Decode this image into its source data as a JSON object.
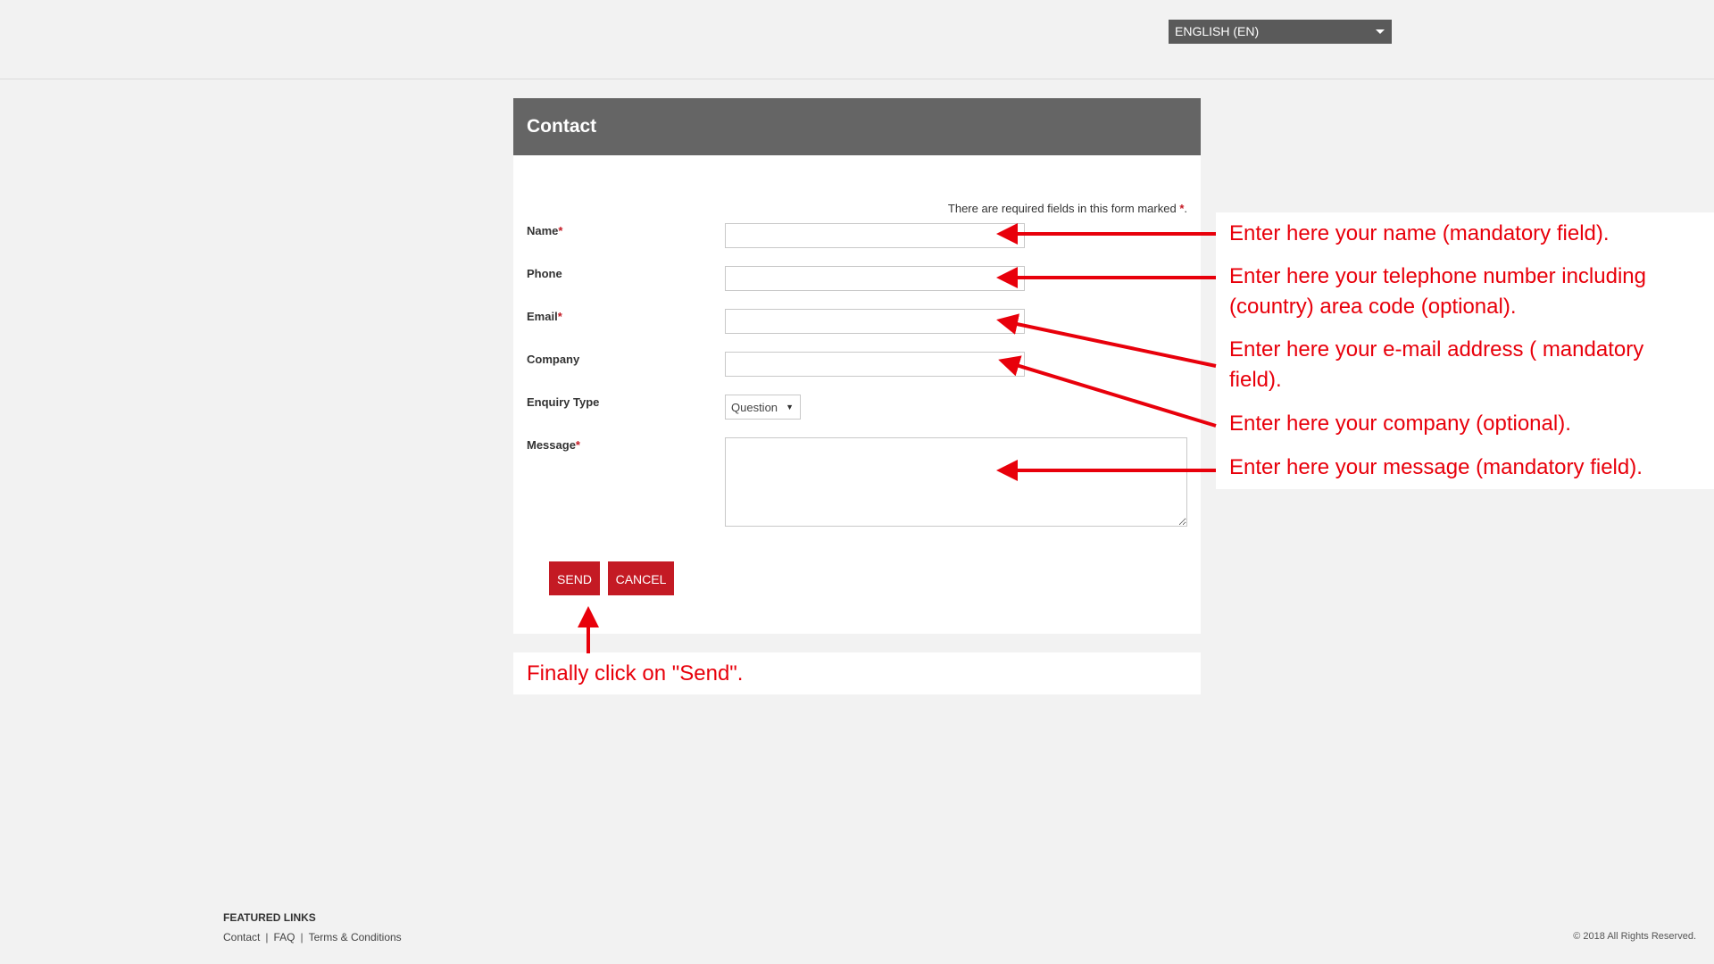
{
  "header": {
    "language_select": {
      "value": "ENGLISH (EN)",
      "icon": "caret-down-icon"
    }
  },
  "form": {
    "title": "Contact",
    "required_note": "There are required fields in this form marked",
    "required_marker": "*",
    "required_period": ".",
    "fields": {
      "name": {
        "label": "Name",
        "required": true,
        "value": ""
      },
      "phone": {
        "label": "Phone",
        "required": false,
        "value": ""
      },
      "email": {
        "label": "Email",
        "required": true,
        "value": ""
      },
      "company": {
        "label": "Company",
        "required": false,
        "value": ""
      },
      "enquiry_type": {
        "label": "Enquiry Type",
        "value": "Question"
      },
      "message": {
        "label": "Message",
        "required": true,
        "value": ""
      }
    },
    "buttons": {
      "send": "SEND",
      "cancel": "CANCEL"
    }
  },
  "annotations": {
    "name": "Enter here your name (mandatory field).",
    "phone": "Enter here your telephone number including (country) area code (optional).",
    "email": "Enter here your e-mail address ( mandatory field).",
    "company": "Enter here your company (optional).",
    "message": "Enter here your message (mandatory field).",
    "send": "Finally click on \"Send\"."
  },
  "footer": {
    "heading": "FEATURED LINKS",
    "links": [
      "Contact",
      "FAQ",
      "Terms & Conditions"
    ],
    "separator": "|",
    "copyright": "© 2018 All Rights Reserved."
  },
  "colors": {
    "page_background": "#f2f2f2",
    "header_bar": "#656565",
    "accent_button": "#c41a24",
    "annotation_red": "#e8000b"
  }
}
